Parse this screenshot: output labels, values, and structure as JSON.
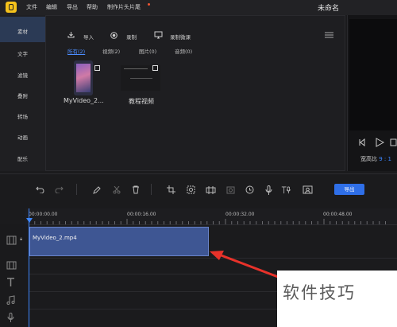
{
  "titlebar": {
    "menus": [
      "文件",
      "编辑",
      "导出",
      "帮助",
      "制作片头片尾"
    ],
    "doc_title": "未命名"
  },
  "sidebar": {
    "items": [
      "素材",
      "文字",
      "滤镜",
      "叠附",
      "转场",
      "动画",
      "配乐"
    ],
    "active_index": 0
  },
  "media": {
    "tools": {
      "import": "导入",
      "record": "录制",
      "record_lesson": "录制微课"
    },
    "filters": [
      "所有(2)",
      "视频(2)",
      "图片(0)",
      "音频(0)"
    ],
    "active_filter": 0,
    "items": [
      {
        "name": "MyVideo_2..."
      },
      {
        "name": "教程视频"
      }
    ]
  },
  "preview": {
    "aspect_label": "宽高比",
    "aspect_value": "9 : 1"
  },
  "toolbar": {
    "export_label": "导出"
  },
  "timeline": {
    "ticks": [
      "00:00:00.00",
      "00:00:16.00",
      "00:00:32.00",
      "00:00:48.00"
    ],
    "clip_name": "MyVideo_2.mp4"
  },
  "watermark": "软件技巧",
  "colors": {
    "accent": "#3d86ff",
    "clip_fill": "#3e5693",
    "logo": "#f5c21b",
    "arrow": "#e8322a"
  }
}
